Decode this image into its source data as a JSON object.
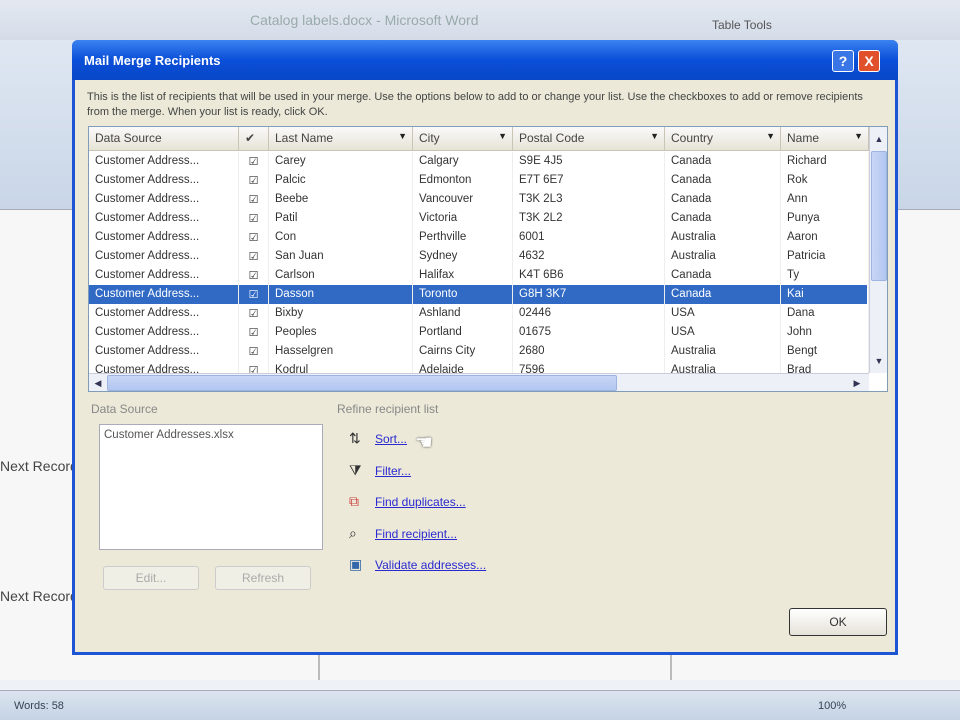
{
  "app": {
    "title": "Catalog labels.docx - Microsoft Word",
    "contextual_tab": "Table Tools",
    "next_record": "Next Record",
    "status_words": "Words: 58",
    "zoom": "100%"
  },
  "dialog": {
    "title": "Mail Merge Recipients",
    "help": "?",
    "close": "X",
    "instructions": "This is the list of recipients that will be used in your merge. Use the options below to add to or change your list. Use the checkboxes to add or remove recipients from the merge. When your list is ready, click OK.",
    "columns": [
      "Data Source",
      "✔",
      "Last Name",
      "City",
      "Postal Code",
      "Country",
      "Name"
    ],
    "rows": [
      {
        "source": "Customer Address...",
        "last": "Carey",
        "city": "Calgary",
        "postal": "S9E 4J5",
        "country": "Canada",
        "name": "Richard"
      },
      {
        "source": "Customer Address...",
        "last": "Palcic",
        "city": "Edmonton",
        "postal": "E7T 6E7",
        "country": "Canada",
        "name": "Rok"
      },
      {
        "source": "Customer Address...",
        "last": "Beebe",
        "city": "Vancouver",
        "postal": "T3K 2L3",
        "country": "Canada",
        "name": "Ann"
      },
      {
        "source": "Customer Address...",
        "last": "Patil",
        "city": "Victoria",
        "postal": "T3K 2L2",
        "country": "Canada",
        "name": "Punya"
      },
      {
        "source": "Customer Address...",
        "last": "Con",
        "city": "Perthville",
        "postal": "6001",
        "country": "Australia",
        "name": "Aaron"
      },
      {
        "source": "Customer Address...",
        "last": "San Juan",
        "city": "Sydney",
        "postal": "4632",
        "country": "Australia",
        "name": "Patricia"
      },
      {
        "source": "Customer Address...",
        "last": "Carlson",
        "city": "Halifax",
        "postal": "K4T 6B6",
        "country": "Canada",
        "name": "Ty"
      },
      {
        "source": "Customer Address...",
        "last": "Dasson",
        "city": "Toronto",
        "postal": "G8H 3K7",
        "country": "Canada",
        "name": "Kai"
      },
      {
        "source": "Customer Address...",
        "last": "Bixby",
        "city": "Ashland",
        "postal": "02446",
        "country": "USA",
        "name": "Dana"
      },
      {
        "source": "Customer Address...",
        "last": "Peoples",
        "city": "Portland",
        "postal": "01675",
        "country": "USA",
        "name": "John"
      },
      {
        "source": "Customer Address...",
        "last": "Hasselgren",
        "city": "Cairns City",
        "postal": "2680",
        "country": "Australia",
        "name": "Bengt"
      },
      {
        "source": "Customer Address...",
        "last": "Kodrul",
        "city": "Adelaide",
        "postal": "7596",
        "country": "Australia",
        "name": "Brad"
      }
    ],
    "data_source_label": "Data Source",
    "data_source_item": "Customer Addresses.xlsx",
    "edit": "Edit...",
    "refresh": "Refresh",
    "refine_label": "Refine recipient list",
    "links": [
      "Sort...",
      "Filter...",
      "Find duplicates...",
      "Find recipient...",
      "Validate addresses..."
    ],
    "ok": "OK"
  }
}
